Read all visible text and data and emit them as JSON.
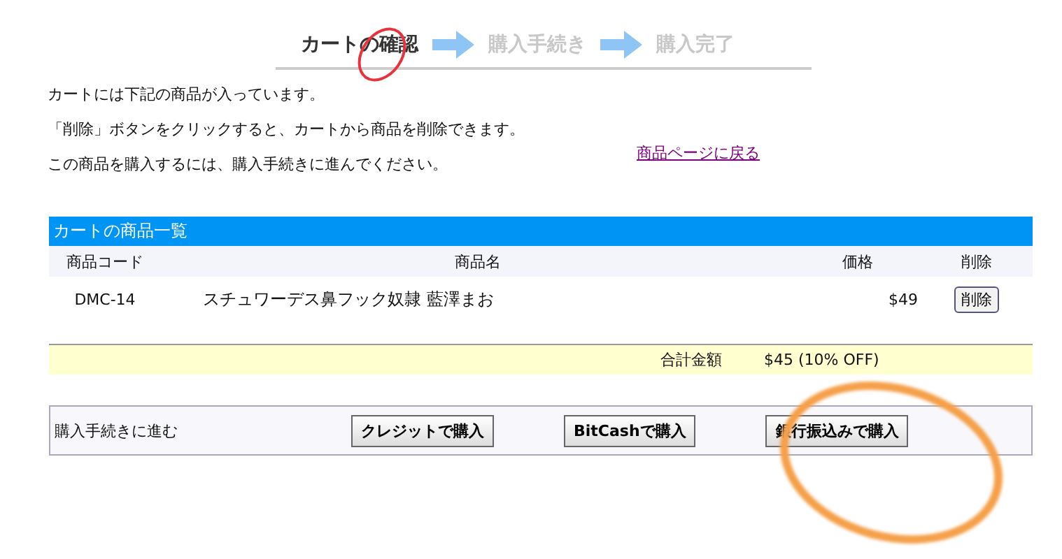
{
  "steps": [
    {
      "label": "カートの確認",
      "selected": true
    },
    {
      "label": "購入手続き",
      "selected": false
    },
    {
      "label": "購入完了",
      "selected": false
    }
  ],
  "intro": [
    "カートには下記の商品が入っています。",
    "「削除」ボタンをクリックすると、カートから商品を削除できます。",
    "この商品を購入するには、購入手続きに進んでください。"
  ],
  "back_link": "商品ページに戻る",
  "cart": {
    "title": "カートの商品一覧",
    "columns": [
      "商品コード",
      "商品名",
      "価格",
      "削除"
    ],
    "rows": [
      {
        "code": "DMC-14",
        "name": "スチュワーデス鼻フック奴隷  藍澤まお",
        "price": "$49",
        "action": "削除"
      }
    ],
    "total_label": "合計金額",
    "total": "$45 (10% OFF)"
  },
  "checkout": {
    "label": "購入手続きに進む",
    "buttons": [
      "クレジットで購入",
      "BitCashで購入",
      "銀行振込みで購入"
    ]
  },
  "annotations": [
    {
      "kind": "small-ellipse",
      "color": "#e8323c"
    },
    {
      "kind": "large-ellipse",
      "color": "#f5a04a"
    }
  ]
}
